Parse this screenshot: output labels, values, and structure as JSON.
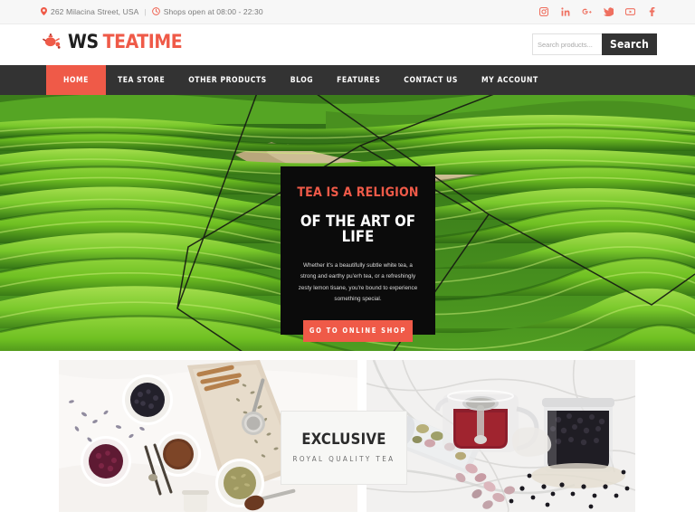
{
  "topbar": {
    "address": "262 Milacina Street, USA",
    "separator": "|",
    "hours": "Shops open at 08:00 - 22:30",
    "pin_icon": "map-pin-icon",
    "clock_icon": "clock-icon",
    "socials": [
      {
        "name": "instagram",
        "glyph": "▣"
      },
      {
        "name": "linkedin",
        "glyph": "in"
      },
      {
        "name": "google-plus",
        "glyph": "g+"
      },
      {
        "name": "twitter",
        "glyph": "✈"
      },
      {
        "name": "youtube",
        "glyph": "▶"
      },
      {
        "name": "facebook",
        "glyph": "f"
      }
    ]
  },
  "header": {
    "logo_primary": "WS",
    "logo_secondary": "TEATIME",
    "logo_icon": "teapot-icon"
  },
  "search": {
    "placeholder": "Search products...",
    "value": "",
    "button_label": "Search"
  },
  "nav": {
    "items": [
      {
        "label": "HOME",
        "active": true
      },
      {
        "label": "TEA STORE",
        "active": false
      },
      {
        "label": "OTHER PRODUCTS",
        "active": false
      },
      {
        "label": "BLOG",
        "active": false
      },
      {
        "label": "FEATURES",
        "active": false
      },
      {
        "label": "CONTACT US",
        "active": false
      },
      {
        "label": "MY ACCOUNT",
        "active": false
      }
    ]
  },
  "hero": {
    "kicker": "TEA IS A RELIGION",
    "title": "OF THE ART OF LIFE",
    "description": "Whether it's a beautifully subtle white tea, a strong and earthy pu'erh tea, or a refreshingly zesty lemon tisane, you're bound to experience something special.",
    "cta_label": "GO TO ONLINE SHOP",
    "background_alt": "tea-plantation-rows",
    "overlay_alt": "geometric-line-polygon"
  },
  "promo": {
    "left_image_alt": "tea-ingredients-bowls-flatlay",
    "right_image_alt": "glass-teapot-and-tea-jars-on-marble",
    "label_title": "EXCLUSIVE",
    "label_subtitle": "ROYAL QUALITY TEA"
  },
  "colors": {
    "accent": "#ef5a48",
    "nav_bg": "#333333",
    "card_bg": "#0b0b0b",
    "topbar_bg": "#f7f7f7",
    "text_muted": "#7b7b7b"
  }
}
